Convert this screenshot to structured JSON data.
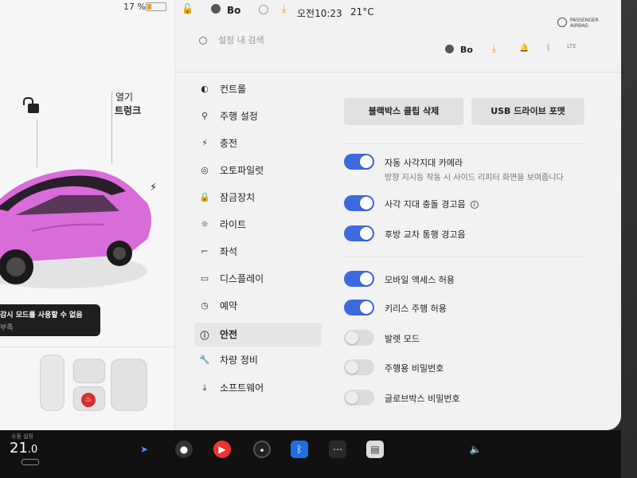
{
  "status_bar": {
    "battery_pct": "17 %",
    "user_name": "Bo",
    "time": "오전10:23",
    "temperature": "21°C",
    "airbag_line1": "PASSENGER",
    "airbag_line2": "AIRBAG"
  },
  "car_panel": {
    "trunk_open": "열기",
    "trunk_label": "트렁크",
    "warning_title": "감시 모드를 사용할 수 없음",
    "warning_sub": "부족"
  },
  "search": {
    "placeholder": "설정 내 검색"
  },
  "header": {
    "user_name": "Bo",
    "lte": "LTE"
  },
  "menu": {
    "items": [
      {
        "label": "컨트롤",
        "icon": "toggle-icon"
      },
      {
        "label": "주행 설정",
        "icon": "car-icon"
      },
      {
        "label": "충전",
        "icon": "bolt-icon"
      },
      {
        "label": "오토파일럿",
        "icon": "steering-wheel-icon"
      },
      {
        "label": "잠금장치",
        "icon": "lock-icon"
      },
      {
        "label": "라이트",
        "icon": "light-icon"
      },
      {
        "label": "좌석",
        "icon": "seat-icon"
      },
      {
        "label": "디스플레이",
        "icon": "display-icon"
      },
      {
        "label": "예약",
        "icon": "clock-icon"
      },
      {
        "label": "안전",
        "icon": "safety-icon",
        "active": true
      },
      {
        "label": "차량 정비",
        "icon": "wrench-icon"
      },
      {
        "label": "소프트웨어",
        "icon": "download-icon"
      }
    ]
  },
  "buttons": {
    "delete_dashcam": "블랙박스 클립 삭제",
    "format_usb": "USB 드라이브 포맷"
  },
  "settings": {
    "toggles": [
      {
        "label": "자동 사각지대 카메라",
        "sub": "방향 지시등 작동 시 사이드 리피터 화면을 보여줍니다",
        "on": true
      },
      {
        "label": "사각 지대 충돌 경고음",
        "info": "i",
        "on": true
      },
      {
        "label": "후방 교차 통행 경고음",
        "on": true
      },
      {
        "label": "모바일 액세스 허용",
        "on": true
      },
      {
        "label": "키리스 주행 허용",
        "on": true
      },
      {
        "label": "발렛 모드",
        "on": false
      },
      {
        "label": "주행용 비밀번호",
        "on": false
      },
      {
        "label": "글로브박스 비밀번호",
        "on": false
      }
    ]
  },
  "taskbar": {
    "temp_label": "수동 설정",
    "temp_whole": "21",
    "temp_decimal": ".0",
    "icons": [
      "navigation-icon",
      "camera-icon",
      "youtube-icon",
      "dashcam-icon",
      "bluetooth-icon",
      "more-icon",
      "notes-icon",
      "volume-icon"
    ]
  },
  "colors": {
    "toggle_on": "#3e6ae0",
    "accent": "#e5a033",
    "car": "#d86cd8"
  }
}
